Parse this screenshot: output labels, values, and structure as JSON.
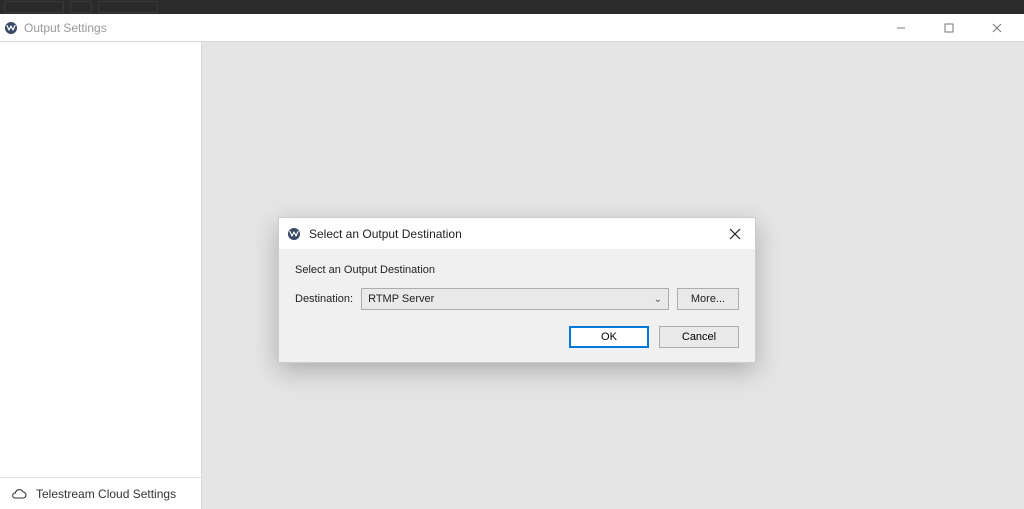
{
  "window": {
    "title": "Output Settings"
  },
  "sidebar": {
    "cloud_settings_label": "Telestream Cloud Settings"
  },
  "modal": {
    "title": "Select an Output Destination",
    "prompt": "Select an Output Destination",
    "destination_label": "Destination:",
    "destination_value": "RTMP Server",
    "more_label": "More...",
    "ok_label": "OK",
    "cancel_label": "Cancel"
  }
}
